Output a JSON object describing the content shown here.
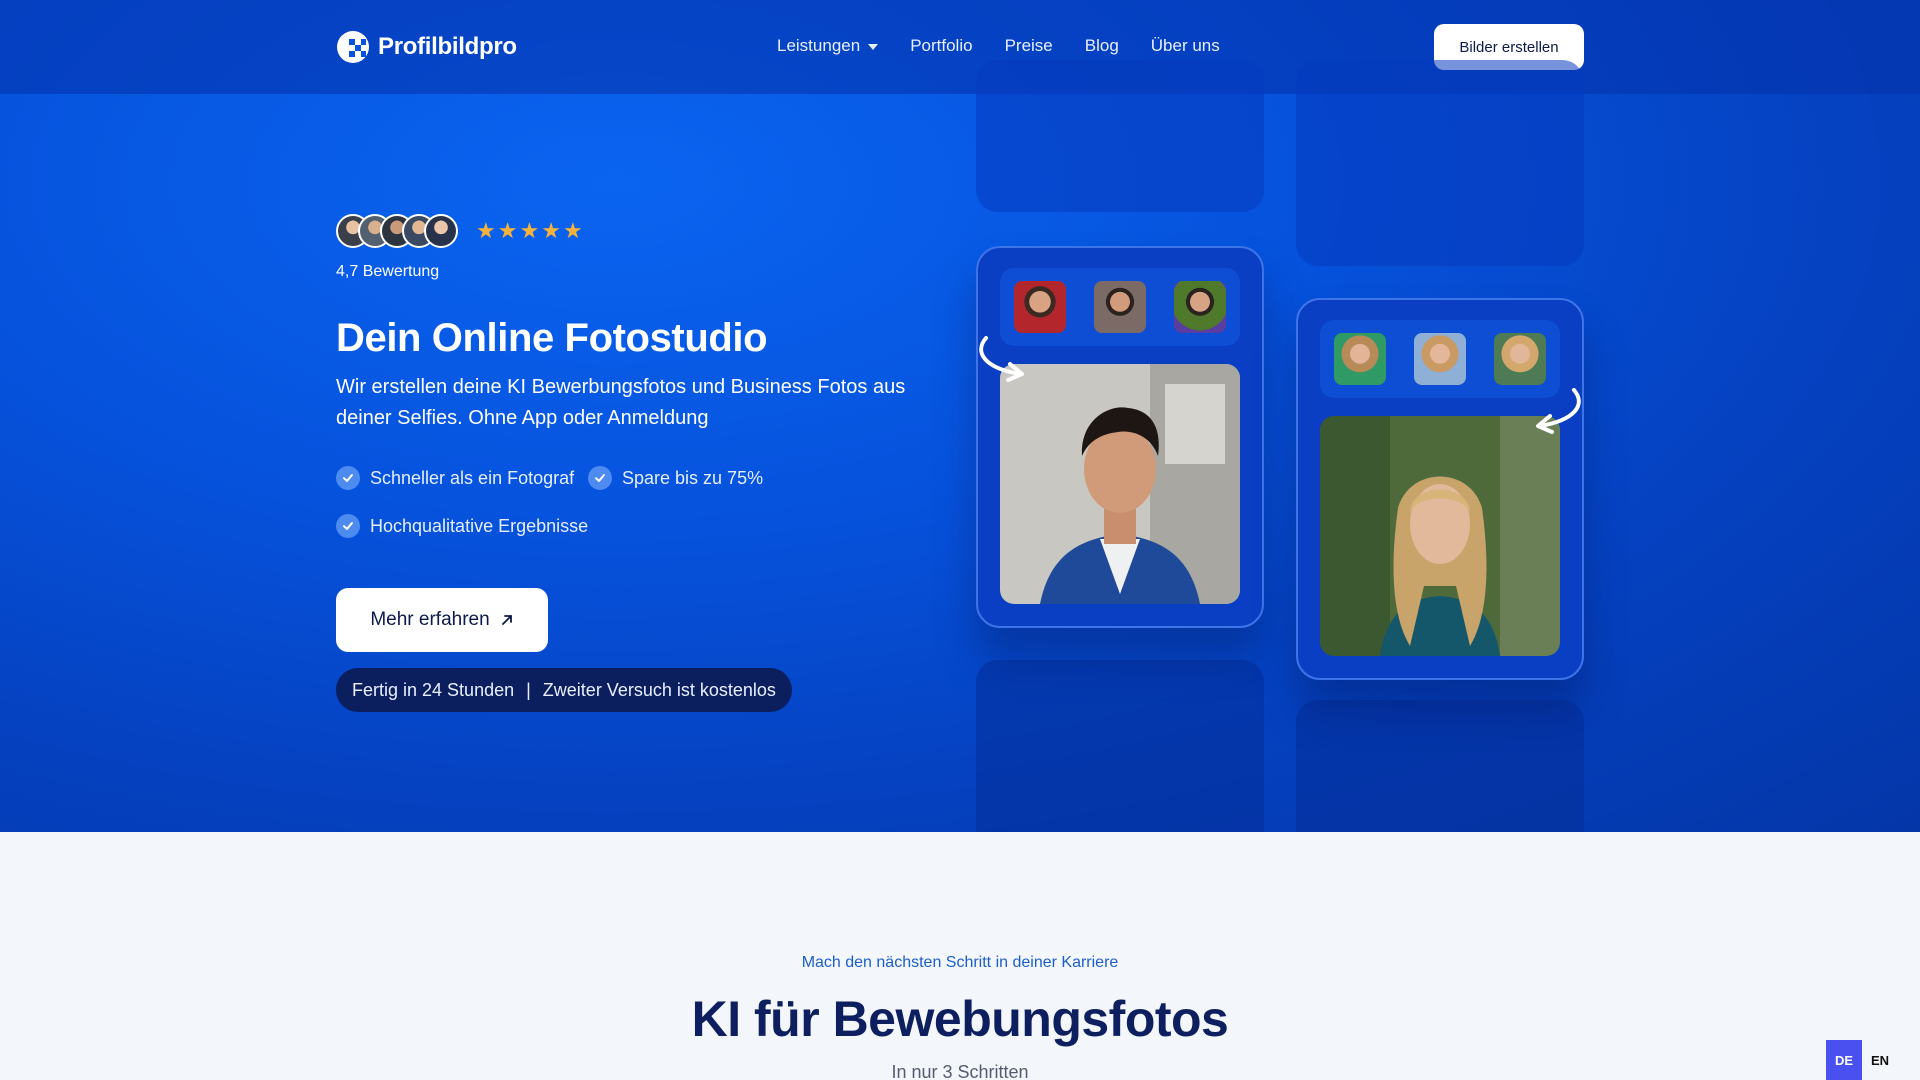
{
  "brand": {
    "name": "Profilbildpro"
  },
  "nav": {
    "items": [
      {
        "label": "Leistungen",
        "has_dropdown": true
      },
      {
        "label": "Portfolio"
      },
      {
        "label": "Preise"
      },
      {
        "label": "Blog"
      },
      {
        "label": "Über uns"
      }
    ],
    "cta_label": "Bilder erstellen"
  },
  "hero": {
    "stars": [
      "★",
      "★",
      "★",
      "★",
      "★"
    ],
    "rating_text": "4,7 Bewertung",
    "headline": "Dein Online Fotostudio",
    "subline": "Wir erstellen deine KI Bewerbungsfotos und Business Fotos aus deiner Selfies. Ohne App oder Anmeldung",
    "features": [
      "Schneller als ein Fotograf",
      "Spare bis zu 75%",
      "Hochqualitative Ergebnisse"
    ],
    "button_label": "Mehr erfahren",
    "note_left": "Fertig in 24 Stunden",
    "note_sep": "|",
    "note_right": "Zweiter Versuch ist kostenlos"
  },
  "section": {
    "kicker": "Mach den nächsten Schritt in deiner Karriere",
    "title": "KI für Bewebungsfotos",
    "subtitle": "In nur 3 Schritten"
  },
  "language": {
    "options": [
      "DE",
      "EN"
    ],
    "active": "DE"
  },
  "colors": {
    "brand_blue": "#0652dc",
    "dark_navy": "#0d1f5f",
    "star": "#f6b23a",
    "lang_active": "#4a4ff0"
  }
}
